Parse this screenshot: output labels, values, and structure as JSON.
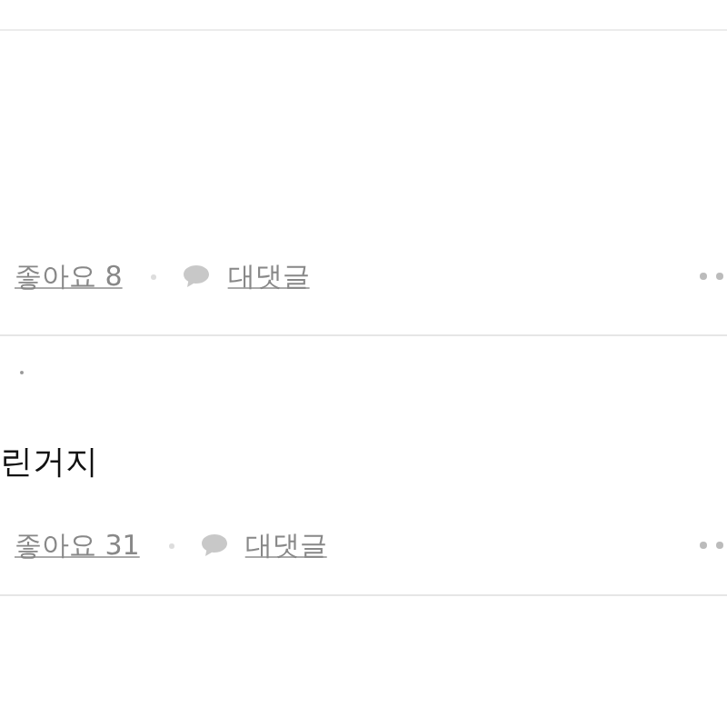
{
  "comments": [
    {
      "like_label": "좋아요 8",
      "reply_label": "대댓글"
    },
    {
      "body": "린거지",
      "like_label": "좋아요 31",
      "reply_label": "대댓글"
    }
  ]
}
